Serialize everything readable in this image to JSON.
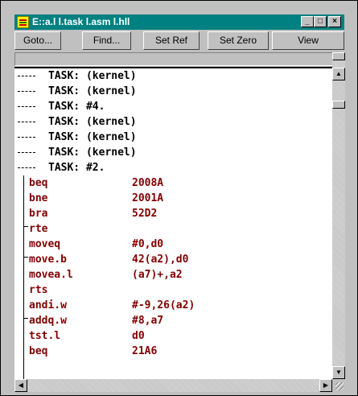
{
  "window": {
    "title": "E::a.l l.task l.asm l.hll",
    "minimize": "_",
    "maximize": "□",
    "close": "×"
  },
  "toolbar": {
    "buttons": [
      "Goto...",
      "Find...",
      "Set Ref",
      "Set Zero",
      "View"
    ]
  },
  "tasks": [
    "TASK: (kernel)",
    "TASK: (kernel)",
    "TASK: #4.",
    "TASK: (kernel)",
    "TASK: (kernel)",
    "TASK: (kernel)",
    "TASK: #2."
  ],
  "instructions": [
    {
      "mnemonic": "beq",
      "operand": "2008A"
    },
    {
      "mnemonic": "bne",
      "operand": "2001A"
    },
    {
      "mnemonic": "bra",
      "operand": "52D2"
    },
    {
      "mnemonic": "rte",
      "operand": ""
    },
    {
      "mnemonic": "moveq",
      "operand": "#0,d0"
    },
    {
      "mnemonic": "move.b",
      "operand": "42(a2),d0"
    },
    {
      "mnemonic": "movea.l",
      "operand": "(a7)+,a2"
    },
    {
      "mnemonic": "rts",
      "operand": ""
    },
    {
      "mnemonic": "andi.w",
      "operand": "#-9,26(a2)"
    },
    {
      "mnemonic": "addq.w",
      "operand": "#8,a7"
    },
    {
      "mnemonic": "tst.l",
      "operand": "d0"
    },
    {
      "mnemonic": "beq",
      "operand": "21A6"
    }
  ],
  "icons": {
    "app": "app-list-icon",
    "scroll_up": "arrow-up-icon",
    "scroll_down": "arrow-down-icon",
    "scroll_left": "arrow-left-icon",
    "scroll_right": "arrow-right-icon"
  },
  "colors": {
    "title_bar": "#008080",
    "instruction_text": "#800000",
    "task_text": "#000000"
  }
}
